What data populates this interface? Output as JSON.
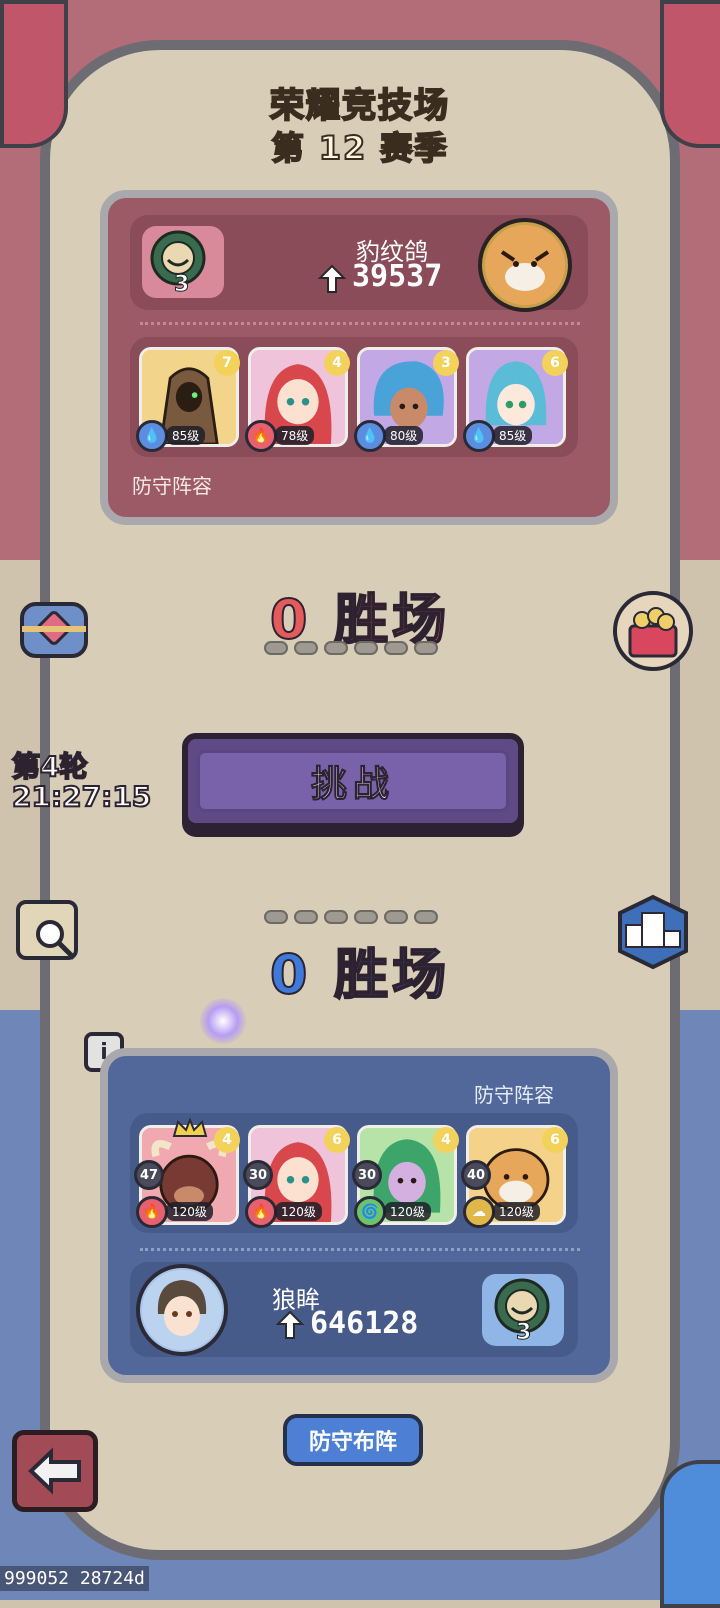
{
  "header": {
    "title": "荣耀竞技场",
    "season": "第 12 赛季"
  },
  "opponent": {
    "name": "豹纹鸽",
    "power": "39537",
    "token_count": "3",
    "lineup_label": "防守阵容",
    "heroes": [
      {
        "stars": "7",
        "level": "85级",
        "element": "water"
      },
      {
        "stars": "4",
        "level": "78级",
        "element": "fire"
      },
      {
        "stars": "3",
        "level": "80级",
        "element": "water"
      },
      {
        "stars": "6",
        "level": "85级",
        "element": "water"
      }
    ]
  },
  "opponent_wins": {
    "label": "0 胜场"
  },
  "round": {
    "label": "第4轮",
    "timer": "21:27:15"
  },
  "challenge": {
    "label": "挑战"
  },
  "player_wins": {
    "label": "0 胜场"
  },
  "player": {
    "name": "狼眸",
    "power": "646128",
    "token_count": "3",
    "lineup_label": "防守阵容",
    "heroes": [
      {
        "stars": "4",
        "level": "120级",
        "badge": "47",
        "element": "fire"
      },
      {
        "stars": "6",
        "level": "120级",
        "badge": "30",
        "element": "fire"
      },
      {
        "stars": "4",
        "level": "120级",
        "badge": "30",
        "element": "wind"
      },
      {
        "stars": "6",
        "level": "120级",
        "badge": "40",
        "element": "earth"
      }
    ]
  },
  "deploy": {
    "label": "防守布阵"
  },
  "info": {
    "label": "i"
  },
  "debug": {
    "text": "999052 28724d"
  },
  "colors": {
    "accent_red": "#e45b5b",
    "accent_blue": "#3d7ad9",
    "button_purple": "#7a62aa"
  },
  "icons": [
    "chest-icon",
    "gift-box-icon",
    "search-icon",
    "podium-icon",
    "back-arrow-icon",
    "crown-icon",
    "orb-icon"
  ]
}
